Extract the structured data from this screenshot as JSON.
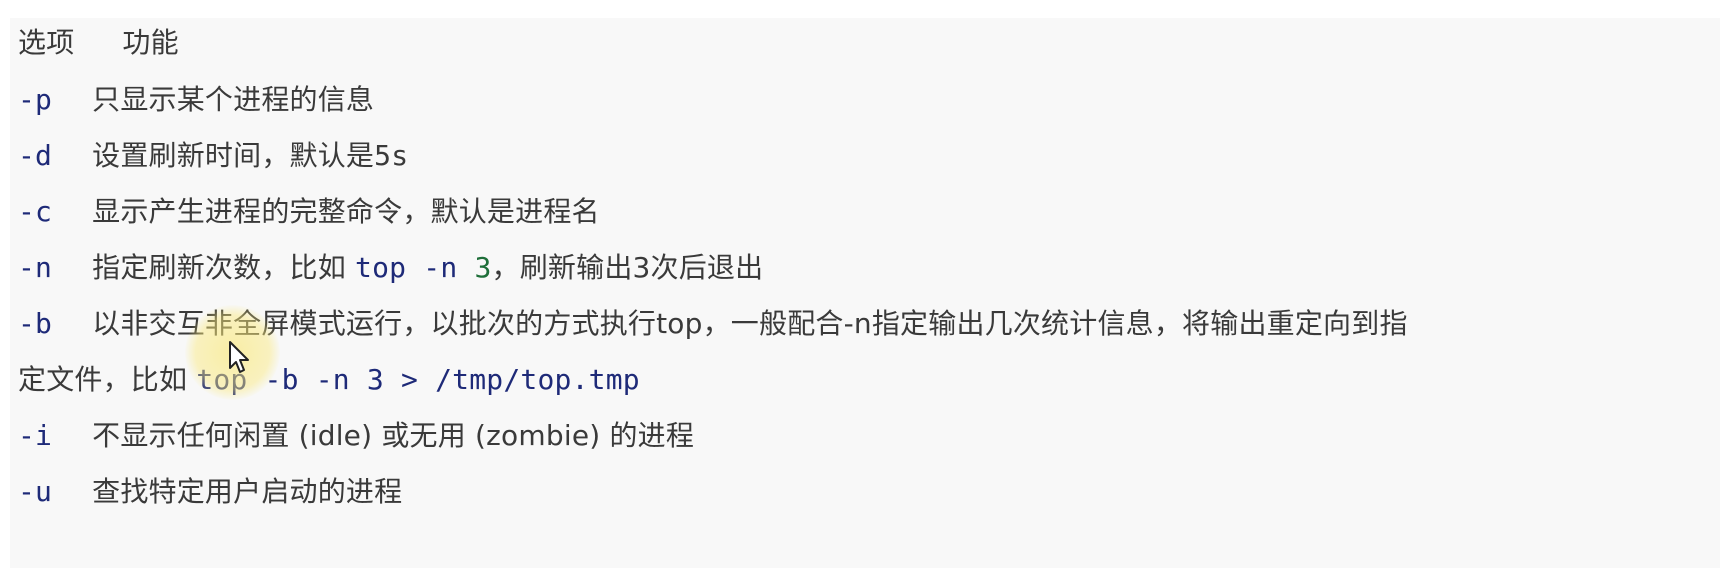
{
  "header": {
    "option": "选项",
    "function": "功能"
  },
  "rows": [
    {
      "option": "-p",
      "desc": "只显示某个进程的信息"
    },
    {
      "option": "-d",
      "desc_pre": "设置刷新时间，默认是",
      "desc_num": "5s"
    },
    {
      "option": "-c",
      "desc": "显示产生进程的完整命令，默认是进程名"
    },
    {
      "option": "-n",
      "desc_pre": "指定刷新次数，比如 ",
      "cmd": "top -n",
      "num": "3",
      "desc_post": "，刷新输出3次后退出"
    },
    {
      "option": "-b",
      "desc_line1": "以非交互非全屏模式运行，以批次的方式执行top，一般配合-n指定输出几次统计信息，将输出重定向到指",
      "desc_line2_pre": "定文件，比如 ",
      "cmd": "top -b -n 3 > /tmp/top.tmp"
    },
    {
      "option": "-i",
      "desc": "不显示任何闲置 (idle) 或无用 (zombie) 的进程"
    },
    {
      "option": "-u",
      "desc": "查找特定用户启动的进程"
    }
  ],
  "colors": {
    "background": "#f8f8f8",
    "option": "#1e2a78",
    "text": "#3a3a3a",
    "number": "#1f6f3a"
  },
  "cursor": {
    "icon": "mouse-pointer-icon"
  }
}
